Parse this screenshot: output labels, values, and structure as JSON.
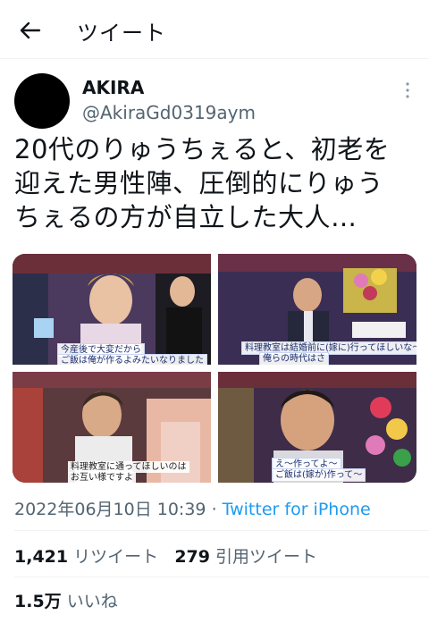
{
  "header": {
    "title": "ツイート"
  },
  "author": {
    "name": "AKIRA",
    "handle": "@AkiraGd0319aym"
  },
  "tweet": {
    "lines": [
      "20代のりゅうちぇると、初老を",
      "迎えた男性陣、圧倒的にりゅう",
      "ちぇるの方が自立した大人…"
    ]
  },
  "media": {
    "captions": {
      "img1": [
        "今産後で大変だから",
        "ご飯は俺が作るよみたいなりました"
      ],
      "img2": [
        "料理教室は結婚前に(嫁に)行ってほしいな～",
        "俺らの時代はさ"
      ],
      "img3": [
        "料理教室に通ってほしいのは",
        "お互い様ですよ"
      ],
      "img4": [
        "え～作ってよ～",
        "ご飯は(嫁が)作って～"
      ]
    }
  },
  "meta": {
    "datetime": "2022年06月10日 10:39",
    "separator": "·",
    "source": "Twitter for iPhone"
  },
  "stats": {
    "retweets": "1,421",
    "retweets_label": "リツイート",
    "quotes": "279",
    "quotes_label": "引用ツイート",
    "likes": "1.5万",
    "likes_label": "いいね"
  }
}
